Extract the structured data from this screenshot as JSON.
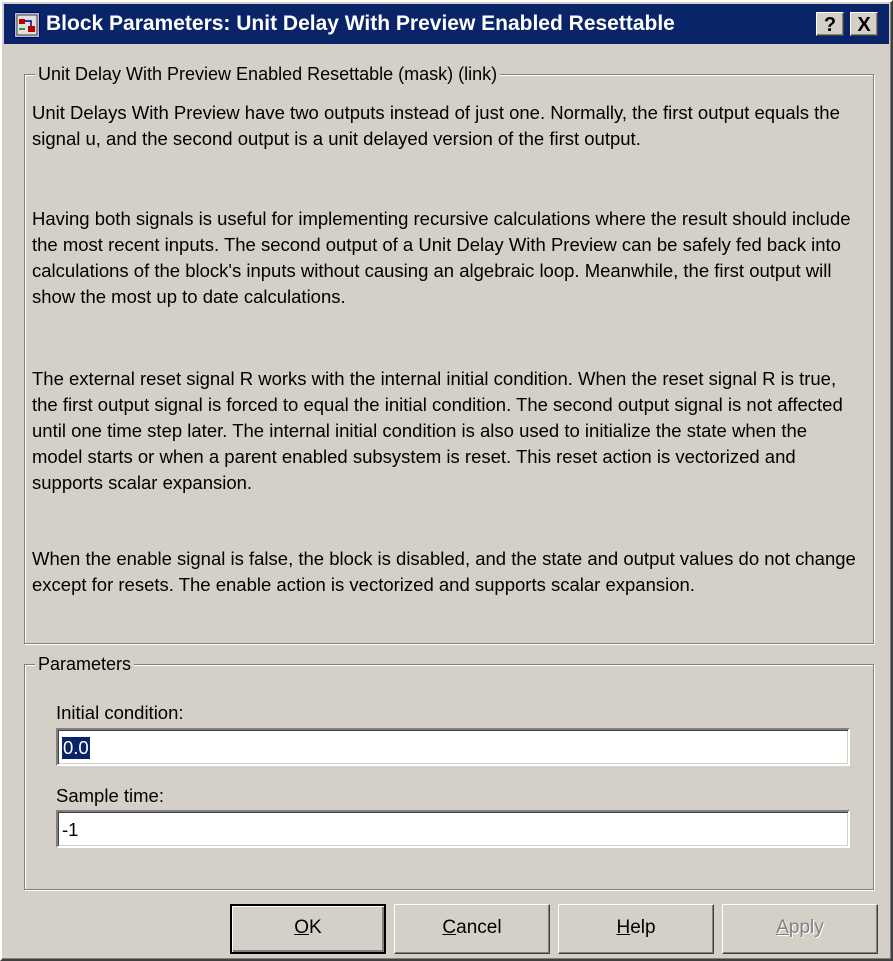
{
  "window": {
    "title": "Block Parameters: Unit Delay With Preview Enabled Resettable",
    "help_btn": "?",
    "close_btn": "X"
  },
  "description_group": {
    "legend": "Unit Delay With Preview Enabled Resettable (mask) (link)",
    "paragraphs": [
      "Unit Delays With Preview have two outputs instead of just one.  Normally, the first output equals the signal u, and the second output is a unit delayed version of the first output.",
      "Having both signals is useful for implementing recursive calculations where the result should include the most recent inputs.  The second output of a Unit Delay With Preview can be safely fed back into calculations of the block's inputs without causing an algebraic loop.  Meanwhile, the first output will show the most up to date calculations.",
      "The external reset signal R works with the internal initial condition.  When the reset signal R is true, the first output signal is forced to equal the initial condition.  The second output signal is not affected until one time step later.  The internal initial condition is also used to initialize the state when the model starts or when a parent enabled subsystem is reset.  This reset action is vectorized and supports scalar expansion.",
      "When the enable signal is false, the block is disabled, and the state and output values do not change except for resets.  The enable action is vectorized and supports scalar expansion."
    ]
  },
  "parameters_group": {
    "legend": "Parameters",
    "initial_condition": {
      "label": "Initial condition:",
      "value": "0.0"
    },
    "sample_time": {
      "label": "Sample time:",
      "value": "-1"
    }
  },
  "buttons": {
    "ok": {
      "mnemonic": "O",
      "rest": "K"
    },
    "cancel": {
      "mnemonic": "C",
      "rest": "ancel"
    },
    "help": {
      "mnemonic": "H",
      "rest": "elp"
    },
    "apply": {
      "mnemonic": "A",
      "rest": "pply"
    }
  },
  "colors": {
    "title_bar": "#0a246a",
    "face": "#d4d0c8",
    "selection": "#0a246a"
  },
  "icons": [
    "simulink-block-icon",
    "help-icon",
    "close-icon"
  ]
}
